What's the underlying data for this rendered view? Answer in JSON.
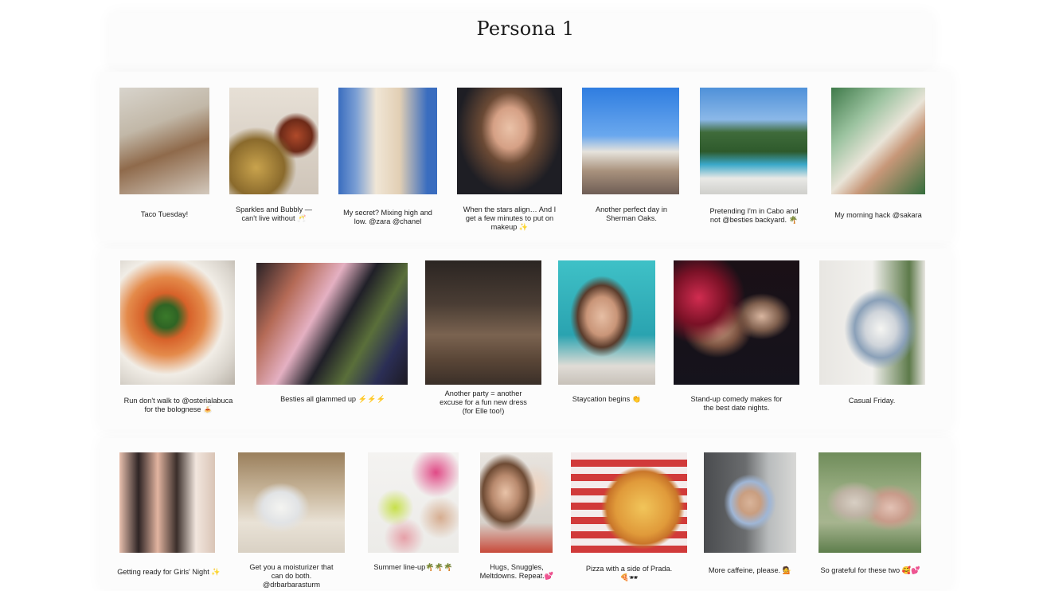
{
  "page": {
    "title": "Persona 1"
  },
  "rows": [
    [
      {
        "caption": "Taco Tuesday!",
        "photo": "woman-drinking-at-bar-photo"
      },
      {
        "caption": "Sparkles and Bubbly —\ncan't live without 🥂",
        "photo": "champagne-and-clutch-photo"
      },
      {
        "caption": "My secret? Mixing high and\nlow. @zara @chanel",
        "photo": "open-back-blouse-photo"
      },
      {
        "caption": "When the stars align… And I\nget a few minutes to put on\nmakeup ✨",
        "photo": "makeup-portrait-photo"
      },
      {
        "caption": "Another perfect day in\nSherman Oaks.",
        "photo": "sandals-poolside-photo"
      },
      {
        "caption": "Pretending I'm in Cabo and\nnot @besties backyard. 🌴",
        "photo": "backyard-pool-photo"
      },
      {
        "caption": "My morning hack @sakara",
        "photo": "supplement-hand-photo"
      }
    ],
    [
      {
        "caption": "Run don't walk to @osterialabuca\nfor the bolognese 🍝",
        "photo": "pasta-bowl-photo"
      },
      {
        "caption": "Besties all glammed up ⚡⚡⚡",
        "photo": "friends-glammed-up-photo"
      },
      {
        "caption": "Another party = another\nexcuse for a fun new dress\n(for Elle too!)",
        "photo": "party-dancing-photo"
      },
      {
        "caption": "Staycation begins 👏",
        "photo": "pool-sunglasses-photo"
      },
      {
        "caption": "Stand-up comedy makes for\nthe best date nights.",
        "photo": "date-night-photo"
      },
      {
        "caption": "Casual Friday.",
        "photo": "casual-friday-photo"
      }
    ],
    [
      {
        "caption": "Getting ready for Girls' Night ✨",
        "photo": "girls-mirror-selfie-photo"
      },
      {
        "caption": "Get you a moisturizer that\ncan do both.\n@drbarbarasturm",
        "photo": "moisturizer-jar-photo"
      },
      {
        "caption": "Summer line-up🌴🌴🌴",
        "photo": "summer-shoes-photo"
      },
      {
        "caption": "Hugs, Snuggles,\nMeltdowns. Repeat.💕",
        "photo": "mom-and-child-photo"
      },
      {
        "caption": "Pizza with a side of Prada.\n🍕🕶",
        "photo": "pizza-table-photo"
      },
      {
        "caption": "More caffeine, please. 💁",
        "photo": "street-outfit-photo"
      },
      {
        "caption": "So grateful for these two 🥰💕",
        "photo": "family-portrait-photo"
      }
    ]
  ],
  "colors": {
    "background": "#ffffff",
    "panel": "#fcfcfc",
    "text": "#1e1e1e"
  }
}
